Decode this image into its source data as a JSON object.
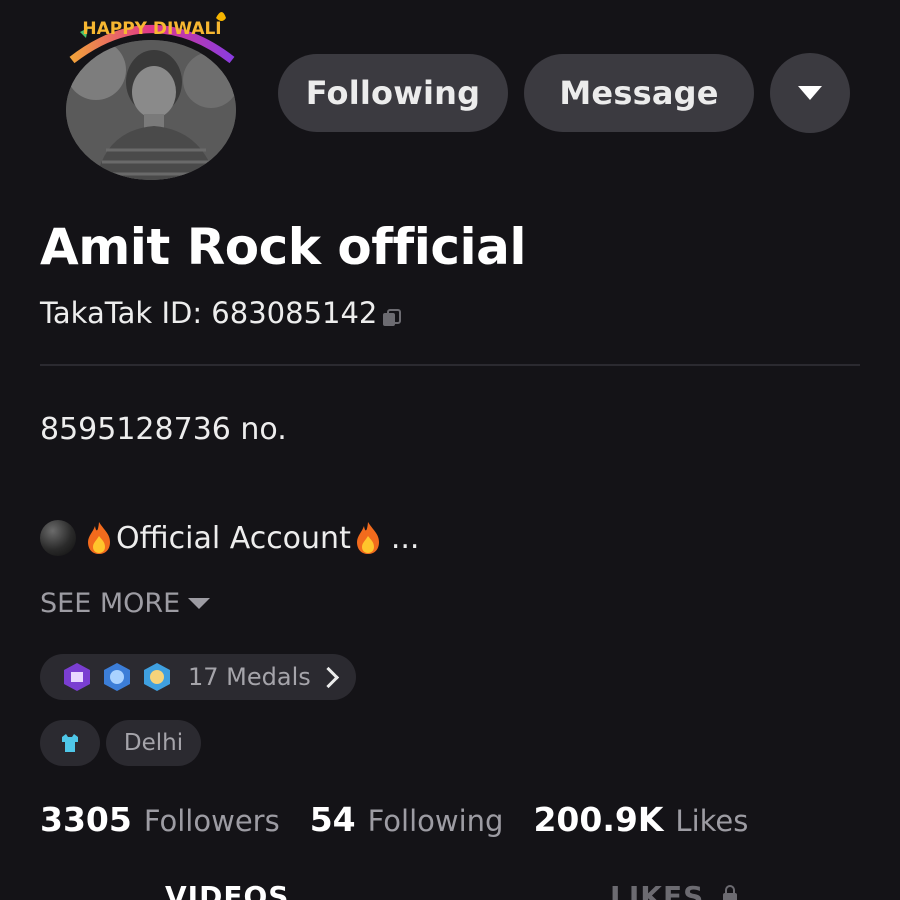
{
  "profile": {
    "avatar_frame_text": "HAPPY DIWALI",
    "name": "Amit Rock official",
    "takatak_id": "TakaTak ID: 683085142",
    "bio_line1": "8595128736 no.",
    "bio_line2_text": "Official Account",
    "bio_ellipsis": "...",
    "see_more": "SEE MORE",
    "medals_label": "17 Medals",
    "location": "Delhi"
  },
  "actions": {
    "following": "Following",
    "message": "Message"
  },
  "stats": [
    {
      "value": "3305",
      "label": "Followers"
    },
    {
      "value": "54",
      "label": "Following"
    },
    {
      "value": "200.9K",
      "label": "Likes"
    }
  ],
  "tabs": {
    "videos": "VIDEOS",
    "likes": "LIKES"
  },
  "colors": {
    "background": "#141317",
    "button_bg": "#3b3a40",
    "chip_bg": "#2b2a30",
    "muted_text": "#9d9ca3"
  }
}
